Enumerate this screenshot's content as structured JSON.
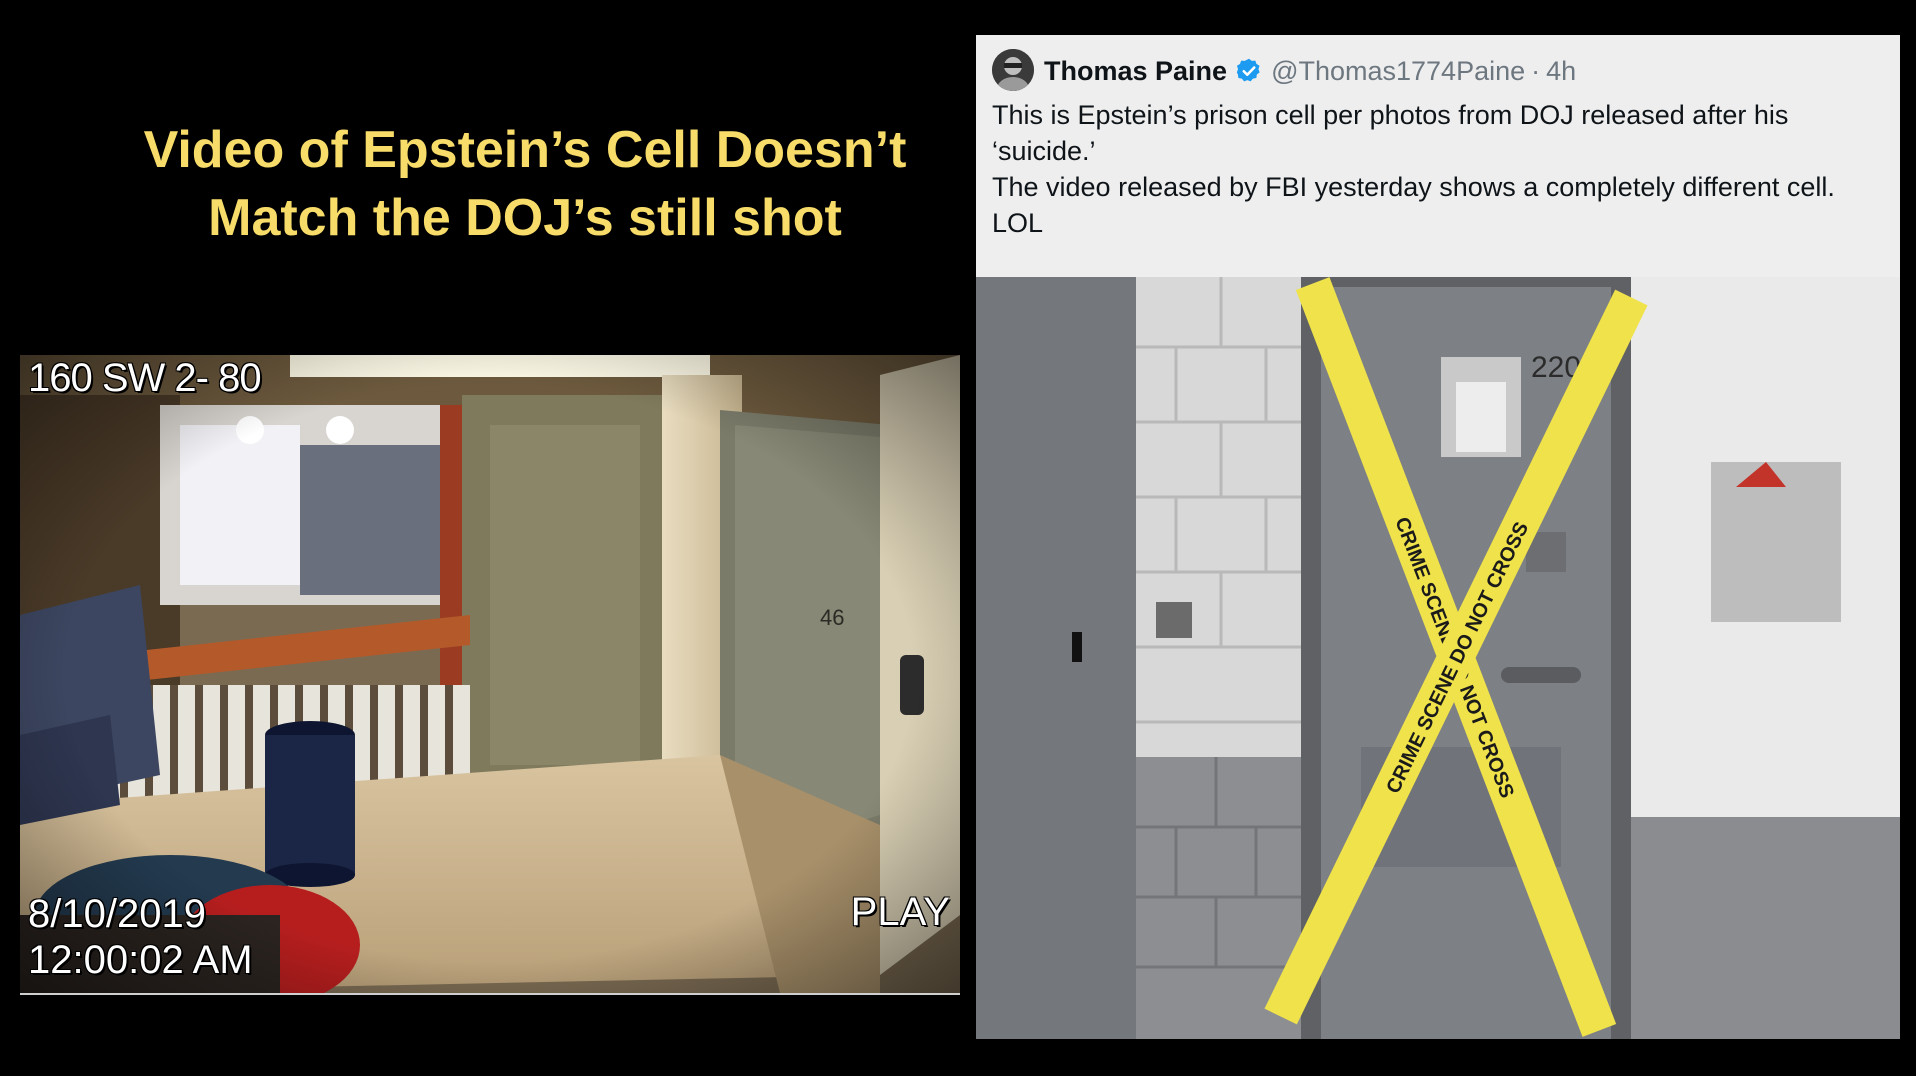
{
  "headline": {
    "line1": "Video of Epstein’s Cell Doesn’t",
    "line2": "Match the DOJ’s still shot"
  },
  "cctv": {
    "camera_label": "160 SW 2- 80",
    "date": "8/10/2019",
    "time": "12:00:02 AM",
    "status": "PLAY",
    "door_number": "46"
  },
  "tweet": {
    "author": "Thomas Paine",
    "handle": "@Thomas1774Paine",
    "separator": "·",
    "age": "4h",
    "verified": true,
    "verified_icon": "verified-badge-icon",
    "body_lines": [
      "This is Epstein’s prison cell per photos from DOJ released after his",
      "‘suicide.’",
      "The video released by FBI yesterday shows a completely different cell.",
      "LOL"
    ]
  },
  "photo": {
    "tape_text": "CRIME SCENE DO NOT CROSS",
    "door_number": "220"
  },
  "colors": {
    "background": "#000000",
    "headline": "#f8dc6a",
    "tweet_bg": "#eeeeee",
    "verified": "#1d9bf0",
    "tape": "#f0e24a"
  }
}
